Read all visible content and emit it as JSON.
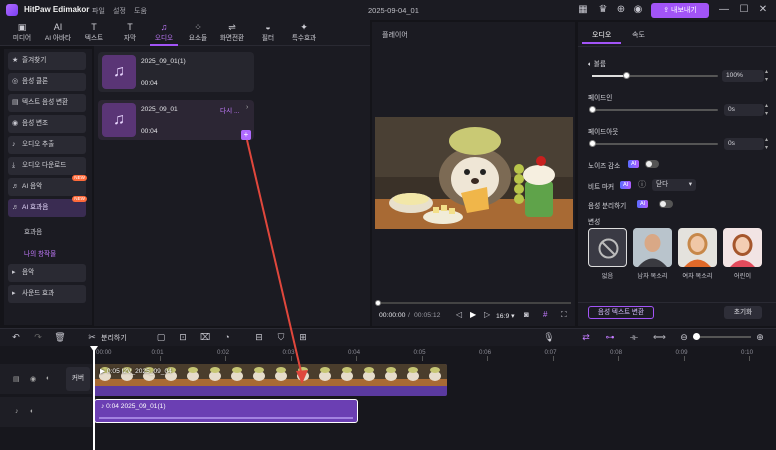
{
  "titlebar": {
    "app_name": "HitPaw Edimakor",
    "menu": [
      "파일",
      "설정",
      "도움"
    ],
    "doc_title": "2025-09-04_01",
    "export_label": "내보내기",
    "icons": [
      "grid-icon",
      "crown-icon",
      "download-icon",
      "user-icon"
    ]
  },
  "toolbar": {
    "tools": [
      {
        "icon": "media-icon",
        "label": "미디어"
      },
      {
        "icon": "ai-icon",
        "label": "AI 아바타"
      },
      {
        "icon": "text-icon",
        "label": "텍스트"
      },
      {
        "icon": "subtitle-icon",
        "label": "자막"
      },
      {
        "icon": "audio-icon",
        "label": "오디오",
        "active": true
      },
      {
        "icon": "elements-icon",
        "label": "요소들"
      },
      {
        "icon": "transition-icon",
        "label": "화면전환"
      },
      {
        "icon": "filter-icon",
        "label": "필터"
      },
      {
        "icon": "effects-icon",
        "label": "특수효과"
      }
    ]
  },
  "sidebar": {
    "items": [
      {
        "label": "즐겨찾기"
      },
      {
        "label": "음성 클론"
      },
      {
        "label": "텍스트 음성 변환"
      },
      {
        "label": "음성 변조"
      },
      {
        "label": "오디오 추출"
      },
      {
        "label": "오디오 다운로드"
      },
      {
        "label": "AI 음악",
        "badge": "NEW"
      },
      {
        "label": "AI 효과음",
        "badge": "NEW",
        "active": true
      }
    ],
    "subitems": [
      "효과음",
      "나의 창작물"
    ],
    "bottom_items": [
      "음악",
      "사운드 효과"
    ]
  },
  "media": {
    "items": [
      {
        "name": "2025_09_01(1)",
        "duration": "00:04"
      },
      {
        "name": "2025_09_01",
        "duration": "00:04",
        "action": "다시 ..."
      }
    ]
  },
  "player": {
    "title": "플레이어",
    "current_time": "00:00:00",
    "total_time": "00:05:12",
    "aspect": "16:9",
    "progress": 0
  },
  "right_panel": {
    "tabs": [
      "오디오",
      "속도"
    ],
    "volume_label": "볼륨",
    "volume_value": "100%",
    "volume_level": 0.27,
    "fade_in_label": "페이드인",
    "fade_in_value": "0s",
    "fade_out_label": "페이드아웃",
    "fade_out_value": "0s",
    "noise_label": "노이즈 감소",
    "beat_label": "비트 마커",
    "beat_value": "닫다",
    "separate_label": "음성 분리하기",
    "voice_change_label": "변성",
    "voices": [
      "없음",
      "남자 목소리",
      "여자 목소리",
      "어린이"
    ],
    "tts_button": "음성 텍스트 변환",
    "reset_button": "초기화",
    "ai_badge": "AI"
  },
  "timeline": {
    "ruler": [
      "00:00",
      "0:01",
      "0:02",
      "0:03",
      "0:04",
      "0:05",
      "0:06",
      "0:07",
      "0:08",
      "0:09",
      "0:10"
    ],
    "split_label": "분리하기",
    "cover_label": "커버",
    "video_clip_label": "0:05 I2V_2025_09_04",
    "audio_clip_label": "0:04 2025_09_01(1)"
  },
  "colors": {
    "accent": "#a254f7",
    "background": "#141419",
    "panel": "#1b1b22",
    "audio_clip": "#6b3fb3",
    "arrow": "#e0473c"
  }
}
